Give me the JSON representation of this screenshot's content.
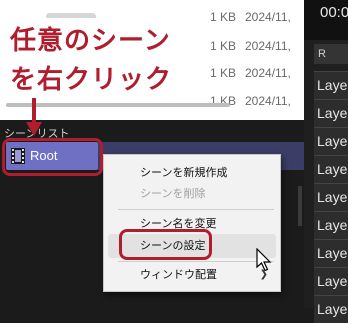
{
  "files": {
    "rows": [
      {
        "size": "1 KB",
        "date": "2024/11,"
      },
      {
        "size": "1 KB",
        "date": "2024/11,"
      },
      {
        "size": "1 KB",
        "date": "2024/11,"
      },
      {
        "size": "1 KB",
        "date": "2024/11,"
      }
    ]
  },
  "time_display": "00:0",
  "right_panel": {
    "header": "R",
    "layers": [
      "Laye",
      "Laye",
      "Laye",
      "Laye",
      "Laye",
      "Laye",
      "Laye",
      "Laye",
      "Laye"
    ]
  },
  "scene_panel": {
    "title": "シーンリスト",
    "items": [
      {
        "label": "Root"
      }
    ]
  },
  "context_menu": {
    "items": [
      {
        "label": "シーンを新規作成",
        "enabled": true
      },
      {
        "label": "シーンを削除",
        "enabled": false
      },
      {
        "label": "シーン名を変更",
        "enabled": true
      },
      {
        "label": "シーンの設定",
        "enabled": true
      },
      {
        "label": "ウィンドウ配置",
        "enabled": true,
        "submenu": true
      }
    ]
  },
  "annotation": {
    "line1": "任意のシーン",
    "line2": "を右クリック",
    "color": "#b01e2e"
  },
  "colors": {
    "scene_selected": "#6f70c4",
    "menu_bg": "#f2f2f2",
    "highlight": "#b01e2e"
  }
}
